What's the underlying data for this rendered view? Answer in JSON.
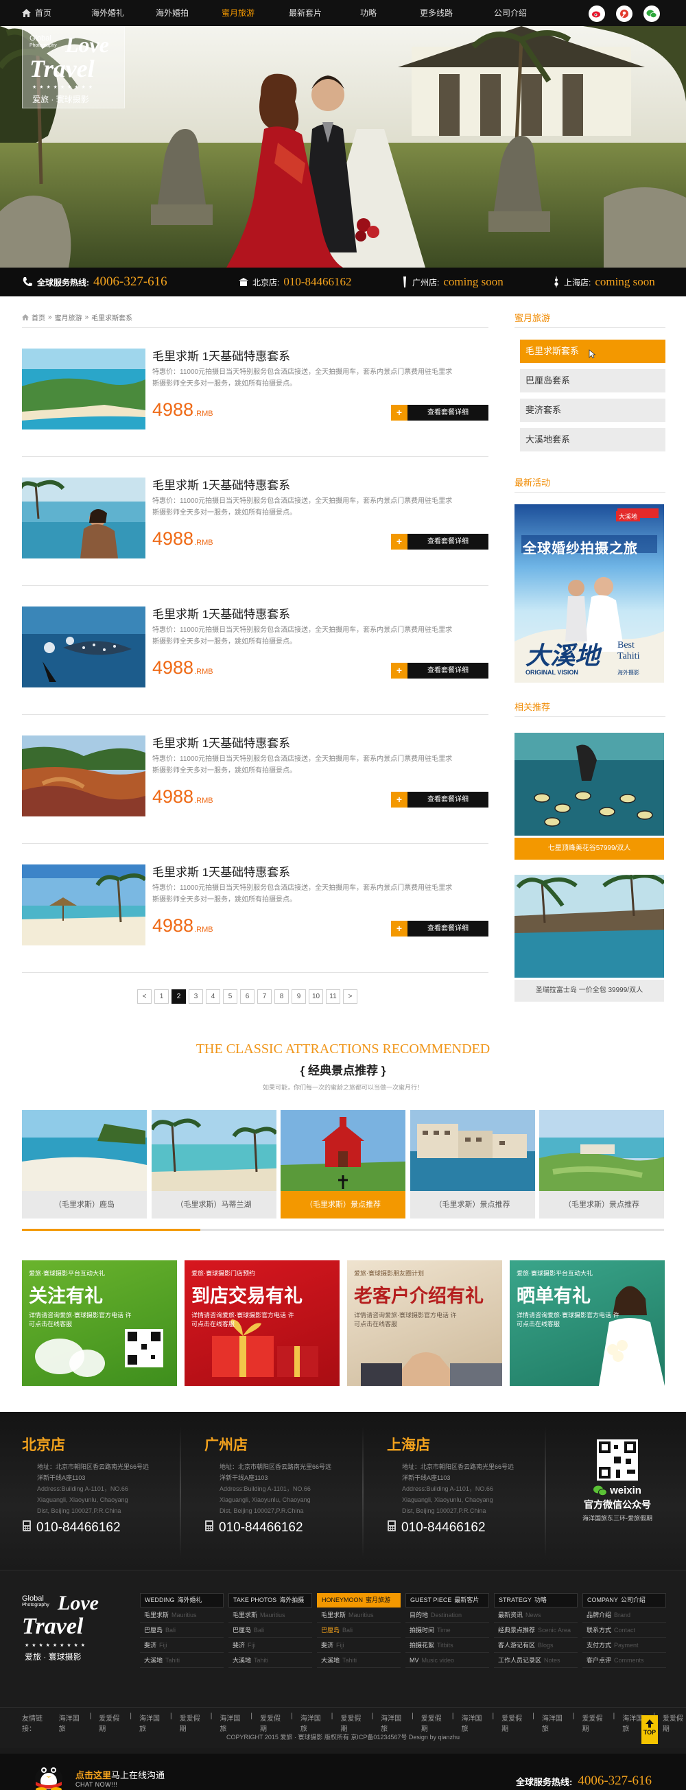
{
  "nav": {
    "home": "首页",
    "items": [
      "海外婚礼",
      "海外婚拍",
      "蜜月旅游",
      "最新套片",
      "功略",
      "更多线路",
      "公司介绍"
    ],
    "active_index": 2
  },
  "logo": {
    "global": "Global",
    "photography": "Photography",
    "love": "Love",
    "travel": "Travel",
    "stars": "★ ★ ★ ★ ★ ★ ★ ★ ★",
    "cn": "爱旅 · 寰球摄影"
  },
  "hotline": {
    "label": "全球服务热线:",
    "number": "4006-327-616",
    "stores": [
      {
        "label": "北京店:",
        "value": "010-84466162"
      },
      {
        "label": "广州店:",
        "value": "coming soon"
      },
      {
        "label": "上海店:",
        "value": "coming soon"
      }
    ]
  },
  "breadcrumb": [
    "首页",
    "蜜月旅游",
    "毛里求斯套系"
  ],
  "breadcrumb_sep": "»",
  "packages": [
    {
      "title": "毛里求斯 1天基础特惠套系",
      "desc1": "特惠价：11000元拍摄日当天特别服务包含酒店接送，全天拍摄用车，套系内景点门票费用驻毛里求",
      "desc2": "斯摄影师全天多对一服务，跳如所有拍摄景点。",
      "price": "4988",
      "unit": ".RMB",
      "button": "查看套餐详细"
    },
    {
      "title": "毛里求斯 1天基础特惠套系",
      "desc1": "特惠价：11000元拍摄日当天特别服务包含酒店接送，全天拍摄用车，套系内景点门票费用驻毛里求",
      "desc2": "斯摄影师全天多对一服务，跳如所有拍摄景点。",
      "price": "4988",
      "unit": ".RMB",
      "button": "查看套餐详细"
    },
    {
      "title": "毛里求斯 1天基础特惠套系",
      "desc1": "特惠价：11000元拍摄日当天特别服务包含酒店接送，全天拍摄用车，套系内景点门票费用驻毛里求",
      "desc2": "斯摄影师全天多对一服务，跳如所有拍摄景点。",
      "price": "4988",
      "unit": ".RMB",
      "button": "查看套餐详细"
    },
    {
      "title": "毛里求斯 1天基础特惠套系",
      "desc1": "特惠价：11000元拍摄日当天特别服务包含酒店接送，全天拍摄用车，套系内景点门票费用驻毛里求",
      "desc2": "斯摄影师全天多对一服务，跳如所有拍摄景点。",
      "price": "4988",
      "unit": ".RMB",
      "button": "查看套餐详细"
    },
    {
      "title": "毛里求斯 1天基础特惠套系",
      "desc1": "特惠价：11000元拍摄日当天特别服务包含酒店接送，全天拍摄用车，套系内景点门票费用驻毛里求",
      "desc2": "斯摄影师全天多对一服务，跳如所有拍摄景点。",
      "price": "4988",
      "unit": ".RMB",
      "button": "查看套餐详细"
    }
  ],
  "pager": {
    "prev": "<",
    "next": ">",
    "pages": [
      "1",
      "2",
      "3",
      "4",
      "5",
      "6",
      "7",
      "8",
      "9",
      "10",
      "11"
    ],
    "current": "2"
  },
  "sidebar": {
    "honeymoon_heading": "蜜月旅游",
    "menu": [
      "毛里求斯套系",
      "巴厘岛套系",
      "斐济套系",
      "大溪地套系"
    ],
    "active_menu": 0,
    "activity_heading": "最新活动",
    "poster": {
      "top": "全球婚纱拍摄之旅",
      "tag": "大溪地",
      "best": "Best",
      "tahiti": "Tahiti",
      "vision": "ORIGINAL VISION",
      "vision_cn": "海外摄影"
    },
    "related_heading": "相关推荐",
    "related": [
      {
        "caption": "七星顶峰美花谷57999/双人"
      },
      {
        "caption": "圣瑞拉富士岛 一价全包 39999/双人"
      }
    ]
  },
  "attractions": {
    "en_title": "THE CLASSIC ATTRACTIONS RECOMMENDED",
    "cn_title": "{  经典景点推荐  }",
    "subtitle": "如果可能，你们每一次的蜜龄之旅都可以当做一次蜜月行！",
    "cards": [
      "（毛里求斯）鹿岛",
      "（毛里求斯）马蒂兰湖",
      "（毛里求斯）景点推荐",
      "（毛里求斯）景点推荐",
      "（毛里求斯）景点推荐"
    ],
    "active_card": 2
  },
  "promos": [
    {
      "small": "爱旅·寰球摄影平台互动大礼",
      "big": "关注有礼",
      "desc": "详情请咨询爱旅·寰球摄影官方电话 许可点击在线客服"
    },
    {
      "small": "爱旅·寰球摄影门店预约",
      "big": "到店交易有礼",
      "desc": "详情请咨询爱旅·寰球摄影官方电话 许可点击在线客服"
    },
    {
      "small": "爱旅·寰球摄影朋友圈计划",
      "big": "老客户介绍有礼",
      "desc": "详情请咨询爱旅·寰球摄影官方电话 许可点击在线客服"
    },
    {
      "small": "爱旅·寰球摄影平台互动大礼",
      "big": "晒单有礼",
      "desc": "详情请咨询爱旅·寰球摄影官方电话 许可点击在线客服"
    }
  ],
  "stores": [
    {
      "name": "北京店",
      "addr_cn1": "地址：北京市朝阳区香云路南光里66号远",
      "addr_cn2": "洋新干线A座1103",
      "addr_en1": "Address:Building A-1101，NO.66",
      "addr_en2": "Xiaguangli, Xiaoyunlu, Chaoyang",
      "addr_en3": "Dist, Beijing 100027,P.R.China",
      "phone": "010-84466162"
    },
    {
      "name": "广州店",
      "addr_cn1": "地址：北京市朝阳区香云路南光里66号远",
      "addr_cn2": "洋新干线A座1103",
      "addr_en1": "Address:Building A-1101，NO.66",
      "addr_en2": "Xiaguangli, Xiaoyunlu, Chaoyang",
      "addr_en3": "Dist, Beijing 100027,P.R.China",
      "phone": "010-84466162"
    },
    {
      "name": "上海店",
      "addr_cn1": "地址：北京市朝阳区香云路南光里66号远",
      "addr_cn2": "洋新干线A座1103",
      "addr_en1": "Address:Building A-1101，NO.66",
      "addr_en2": "Xiaguangli, Xiaoyunlu, Chaoyang",
      "addr_en3": "Dist, Beijing 100027,P.R.China",
      "phone": "010-84466162"
    }
  ],
  "wechat": {
    "brand": "weixin",
    "title": "官方微信公众号",
    "sub": "海洋国旅东三环-爱旅假期"
  },
  "footer_nav": [
    {
      "en": "WEDDING",
      "cn": "海外婚礼",
      "rows": [
        [
          "毛里求斯",
          "Mauritius"
        ],
        [
          "巴厘岛",
          "Bali"
        ],
        [
          "斐济",
          "Fiji"
        ],
        [
          "大溪地",
          "Tahiti"
        ]
      ]
    },
    {
      "en": "TAKE PHOTOS",
      "cn": "海外拍摄",
      "rows": [
        [
          "毛里求斯",
          "Mauritius"
        ],
        [
          "巴厘岛",
          "Bali"
        ],
        [
          "斐济",
          "Fiji"
        ],
        [
          "大溪地",
          "Tahiti"
        ]
      ]
    },
    {
      "en": "HONEYMOON",
      "cn": "蜜月旅游",
      "rows": [
        [
          "毛里求斯",
          "Mauritius"
        ],
        [
          "巴厘岛",
          "Bali"
        ],
        [
          "斐济",
          "Fiji"
        ],
        [
          "大溪地",
          "Tahiti"
        ]
      ]
    },
    {
      "en": "GUEST PIECE",
      "cn": "最新客片",
      "rows": [
        [
          "目的地",
          "Destination"
        ],
        [
          "拍摄时间",
          "Time"
        ],
        [
          "拍摄花絮",
          "Titbits"
        ],
        [
          "MV",
          "Music video"
        ]
      ]
    },
    {
      "en": "STRATEGY",
      "cn": "功略",
      "rows": [
        [
          "最新资讯",
          "News"
        ],
        [
          "经典景点推荐",
          "Scenic Area"
        ],
        [
          "客人游记有区",
          "Blogs"
        ],
        [
          "工作人员记录区",
          "Notes"
        ]
      ]
    },
    {
      "en": "COMPANY",
      "cn": "公司介绍",
      "rows": [
        [
          "品牌介绍",
          "Brand"
        ],
        [
          "联系方式",
          "Contact"
        ],
        [
          "支付方式",
          "Payment"
        ],
        [
          "客户点评",
          "Comments"
        ]
      ]
    }
  ],
  "footer_active_col": 2,
  "footer_active_row": 1,
  "friend_links": {
    "label": "友情链接：",
    "items": [
      "海洋国旅",
      "爱爱假期",
      "海洋国旅",
      "爱爱假期",
      "海洋国旅",
      "爱爱假期",
      "海洋国旅",
      "爱爱假期",
      "海洋国旅",
      "爱爱假期",
      "海洋国旅",
      "爱爱假期",
      "海洋国旅",
      "爱爱假期",
      "海洋国旅",
      "爱爱假期"
    ]
  },
  "copyright": "COPYRIGHT 2015 爱旅 · 寰球摄影 版权所有 京ICP备01234567号 Design by qianzhu",
  "top_button": "TOP",
  "chat": {
    "line1_a": "点击这里",
    "line1_b": "马上在线沟通",
    "line2": "CHAT NOW!!!"
  },
  "bottom_hotline": {
    "label": "全球服务热线:",
    "number": "4006-327-616"
  },
  "colors": {
    "accent": "#f39800",
    "price": "#ef6a16",
    "dark": "#111111"
  }
}
